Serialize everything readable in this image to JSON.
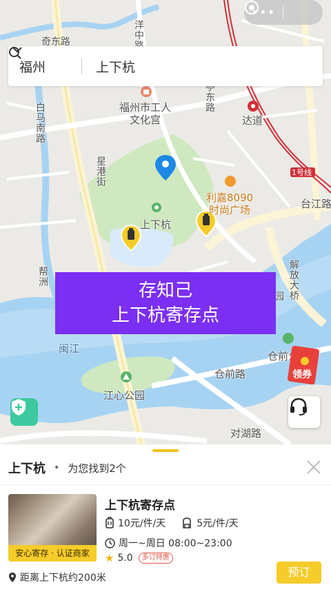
{
  "capsule": {
    "more_glyph": "•••",
    "close_icon": "target-circle-icon"
  },
  "search": {
    "city": "福州",
    "query": "上下杭"
  },
  "map": {
    "labels": {
      "culture_palace_1": "福州市工人",
      "culture_palace_2": "文化宫",
      "dadao": "达道",
      "metro_line": "1号线",
      "lijia_1": "利嘉8090",
      "lijia_2": "时尚广场",
      "shangxiahang": "上下杭",
      "jiangxin": "江心公园",
      "cangqian": "仓前路",
      "duihu": "对湖路",
      "taijiang": "台江路",
      "minjiang": "闽江",
      "baiyu": "白马南路",
      "xinggang": "星港街",
      "jiefang": "解放大桥",
      "bangzhou": "帮洲",
      "yuan": "园",
      "yangzhong": "洋中路",
      "dong_road": "亭东路",
      "cang_short": "仓前公",
      "top_left": "奇东路"
    }
  },
  "banner": {
    "line1": "存知己",
    "line2": "上下杭寄存点"
  },
  "coupon": {
    "label": "领券"
  },
  "sheet": {
    "place": "上下杭",
    "separator": "•",
    "found": "为您找到2个",
    "listing": {
      "title": "上下杭寄存点",
      "price_small": "10元/件/天",
      "price_large": "5元/件/天",
      "hours": "周一~周日 08:00~23:00",
      "rating": "5.0",
      "tag": "多订特惠",
      "cert": "安心寄存 · 认证商家",
      "distance": "距离上下杭约200米",
      "book_label": "预订"
    }
  },
  "colors": {
    "accent": "#f5cc2a",
    "banner": "#7b2ff2",
    "park": "#cfe8c0",
    "water": "#a7d3f2"
  }
}
